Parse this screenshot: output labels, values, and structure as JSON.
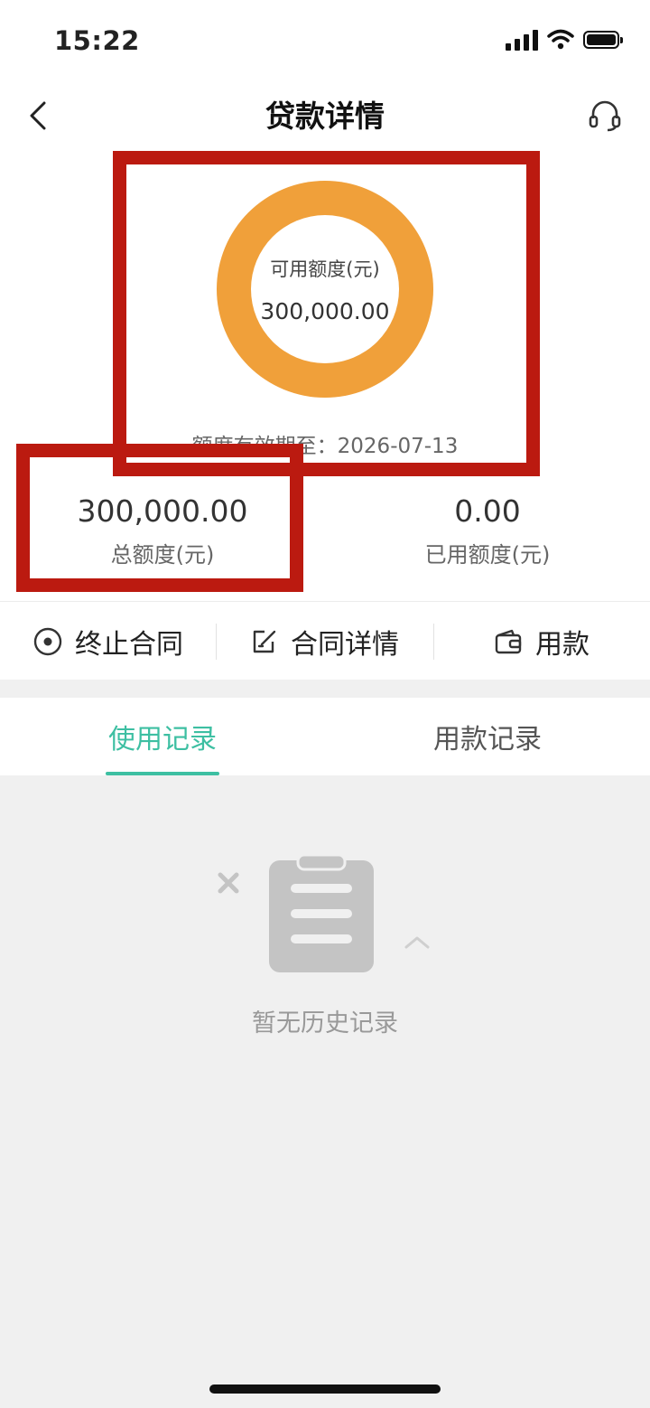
{
  "status_bar": {
    "time": "15:22"
  },
  "nav": {
    "title": "贷款详情"
  },
  "credit": {
    "available_label": "可用额度(元)",
    "available_value": "300,000.00",
    "valid_until": "额度有效期至：2026-07-13",
    "ring_color": "#f0a03a",
    "total_value": "300,000.00",
    "total_label": "总额度(元)",
    "used_value": "0.00",
    "used_label": "已用额度(元)"
  },
  "actions": [
    {
      "label": "终止合同",
      "icon": "stop-circle-icon"
    },
    {
      "label": "合同详情",
      "icon": "edit-document-icon"
    },
    {
      "label": "用款",
      "icon": "wallet-icon"
    }
  ],
  "tabs": [
    {
      "label": "使用记录",
      "active": true
    },
    {
      "label": "用款记录",
      "active": false
    }
  ],
  "empty_state": {
    "text": "暂无历史记录",
    "icon": "clipboard-icon"
  },
  "colors": {
    "accent": "#3dbfa2",
    "annotation": "#bb1a10"
  }
}
